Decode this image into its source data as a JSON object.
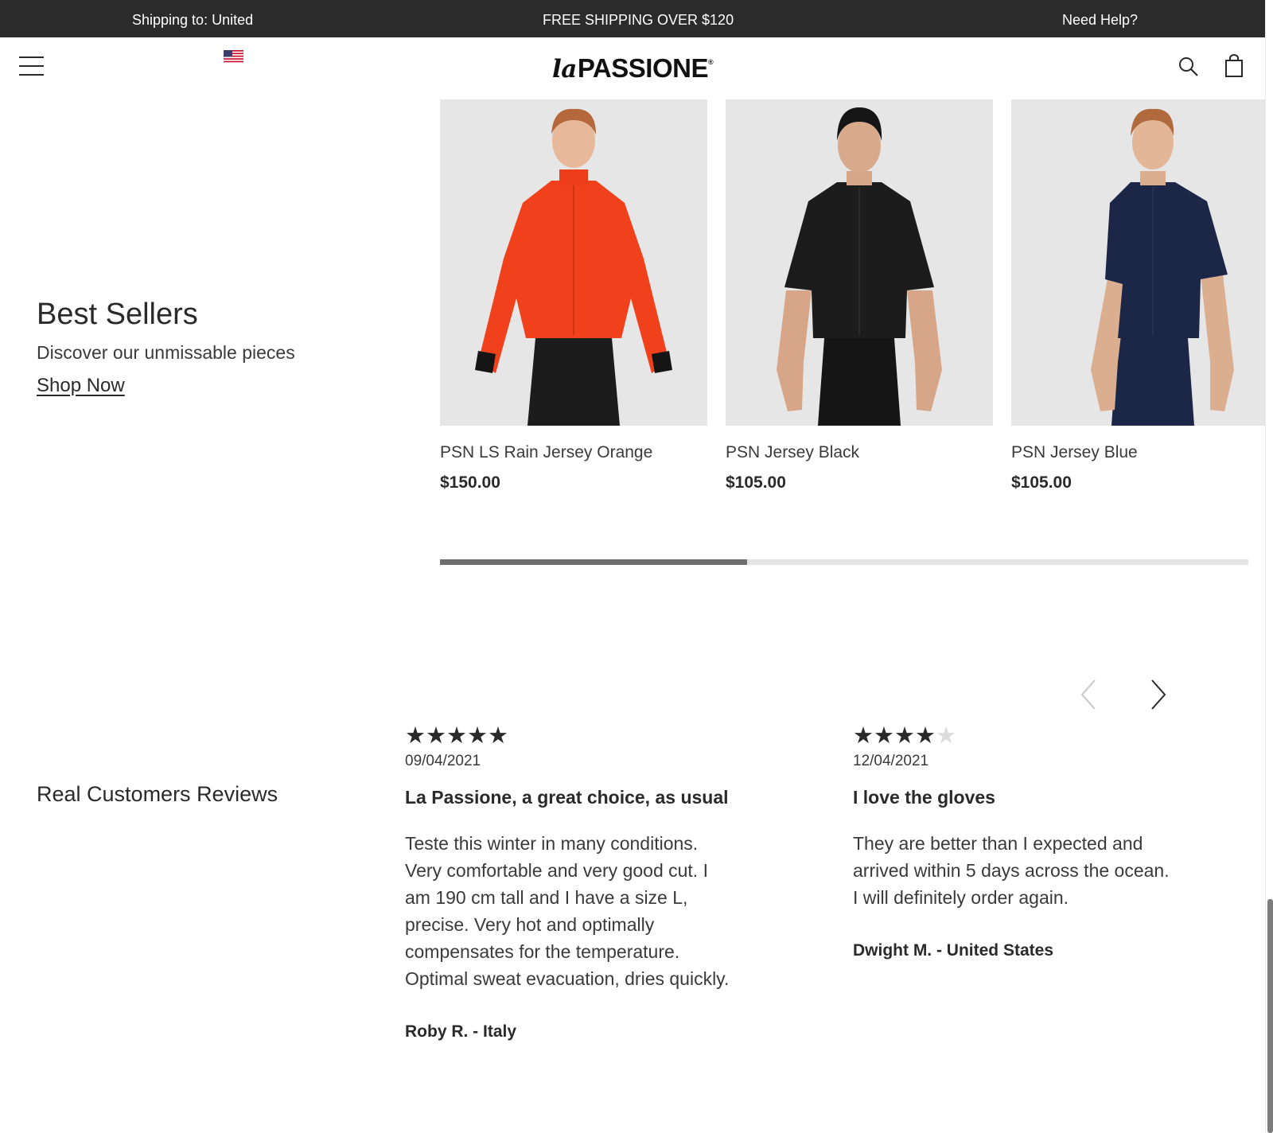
{
  "topbar": {
    "shipping_label": "Shipping to:",
    "shipping_country": "United",
    "promo": "FREE SHIPPING OVER $120",
    "help": "Need Help?"
  },
  "header": {
    "logo_prefix": "la",
    "logo_main": "PASSIONE",
    "logo_mark": "®",
    "icons": [
      "hamburger-menu-icon",
      "us-flag-icon",
      "search-icon",
      "shopping-bag-icon"
    ]
  },
  "best_sellers": {
    "title": "Best Sellers",
    "subtitle": "Discover our unmissable pieces",
    "link": "Shop Now",
    "products": [
      {
        "name": "PSN LS Rain Jersey Orange",
        "price": "$150.00",
        "color": "#f0401c"
      },
      {
        "name": "PSN Jersey Black",
        "price": "$105.00",
        "color": "#1c1c1c"
      },
      {
        "name": "PSN Jersey Blue",
        "price": "$105.00",
        "color": "#1c2647"
      }
    ],
    "carousel_progress": 0.38
  },
  "reviews": {
    "heading": "Real Customers Reviews",
    "nav_icons": [
      "chevron-left-icon",
      "chevron-right-icon"
    ],
    "items": [
      {
        "rating": 5,
        "date": "09/04/2021",
        "title": "La Passione, a great choice, as usual",
        "body": "Teste this winter in many conditions. Very comfortable and very good cut. I am 190 cm tall and I have a size L, precise. Very hot and optimally compensates for the temperature. Optimal sweat evacuation, dries quickly.",
        "author": "Roby R. - Italy"
      },
      {
        "rating": 4,
        "date": "12/04/2021",
        "title": "I love the gloves",
        "body": "They are better than I expected and arrived within 5 days across the ocean. I will definitely order again.",
        "author": "Dwight M. - United States"
      }
    ]
  },
  "colors": {
    "topbar_bg": "#2b2b2b",
    "text": "#2a2a2a",
    "product_bg": "#e6e6e6",
    "progress_fill": "#6e6e6e",
    "progress_track": "#e4e4e4"
  }
}
